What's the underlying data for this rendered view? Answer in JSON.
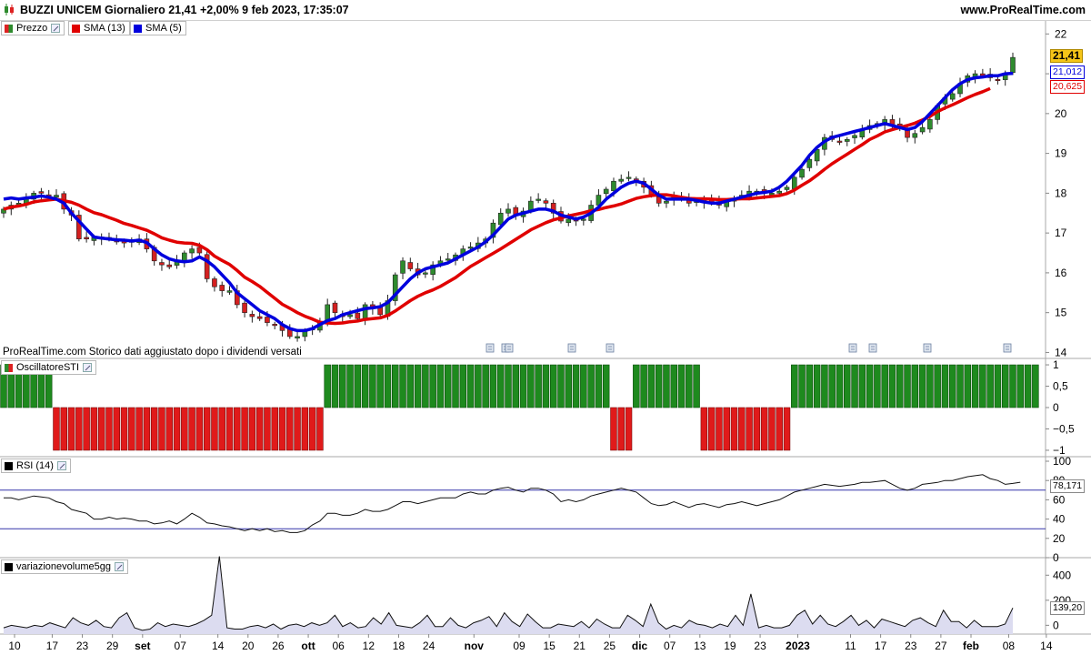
{
  "header": {
    "title": "BUZZI UNICEM Giornaliero 21,41 +2,00% 9 feb 2023, 17:35:07",
    "site": "www.ProRealTime.com"
  },
  "panels": {
    "price": {
      "legend": [
        {
          "label": "Prezzo",
          "color": "#2e8b2e"
        },
        {
          "label": "SMA (13)",
          "color": "#e00000"
        },
        {
          "label": "SMA (5)",
          "color": "#0000dd"
        }
      ],
      "note": "ProRealTime.com  Storico dati aggiustato dopo i dividendi versati",
      "y_ticks": [
        "14",
        "15",
        "16",
        "17",
        "18",
        "19",
        "20",
        "21",
        "22"
      ],
      "value_boxes": {
        "price": "21,41",
        "sma5": "21,012",
        "sma13": "20,625"
      }
    },
    "oscillator": {
      "label": "OscillatoreSTI",
      "y_ticks": [
        "1",
        "0,5",
        "0",
        "−0,5",
        "−1"
      ]
    },
    "rsi": {
      "label": "RSI (14)",
      "y_ticks": [
        "100",
        "80",
        "60",
        "40",
        "20",
        "0"
      ],
      "value_box": "78,171"
    },
    "volume": {
      "label": "variazionevolume5gg",
      "y_ticks": [
        "400",
        "200",
        "0"
      ],
      "value_box": "139,20"
    }
  },
  "x_axis": {
    "labels": [
      {
        "text": "10",
        "i": 0,
        "bold": false
      },
      {
        "text": "17",
        "i": 5,
        "bold": false
      },
      {
        "text": "23",
        "i": 9,
        "bold": false
      },
      {
        "text": "29",
        "i": 13,
        "bold": false
      },
      {
        "text": "set",
        "i": 17,
        "bold": true
      },
      {
        "text": "07",
        "i": 22,
        "bold": false
      },
      {
        "text": "14",
        "i": 27,
        "bold": false
      },
      {
        "text": "20",
        "i": 31,
        "bold": false
      },
      {
        "text": "26",
        "i": 35,
        "bold": false
      },
      {
        "text": "ott",
        "i": 39,
        "bold": true
      },
      {
        "text": "06",
        "i": 43,
        "bold": false
      },
      {
        "text": "12",
        "i": 47,
        "bold": false
      },
      {
        "text": "18",
        "i": 51,
        "bold": false
      },
      {
        "text": "24",
        "i": 55,
        "bold": false
      },
      {
        "text": "nov",
        "i": 61,
        "bold": true
      },
      {
        "text": "09",
        "i": 67,
        "bold": false
      },
      {
        "text": "15",
        "i": 71,
        "bold": false
      },
      {
        "text": "21",
        "i": 75,
        "bold": false
      },
      {
        "text": "25",
        "i": 79,
        "bold": false
      },
      {
        "text": "dic",
        "i": 83,
        "bold": true
      },
      {
        "text": "07",
        "i": 87,
        "bold": false
      },
      {
        "text": "13",
        "i": 91,
        "bold": false
      },
      {
        "text": "19",
        "i": 95,
        "bold": false
      },
      {
        "text": "23",
        "i": 99,
        "bold": false
      },
      {
        "text": "2023",
        "i": 104,
        "bold": true
      },
      {
        "text": "11",
        "i": 111,
        "bold": false
      },
      {
        "text": "17",
        "i": 115,
        "bold": false
      },
      {
        "text": "23",
        "i": 119,
        "bold": false
      },
      {
        "text": "27",
        "i": 123,
        "bold": false
      },
      {
        "text": "feb",
        "i": 127,
        "bold": true
      },
      {
        "text": "08",
        "i": 132,
        "bold": false
      },
      {
        "text": "14",
        "i": 137,
        "bold": false
      }
    ]
  },
  "chart_data": [
    {
      "type": "candlestick",
      "title": "BUZZI UNICEM Giornaliero",
      "series": [
        {
          "name": "Prezzo",
          "values": [
            17.6,
            17.7,
            17.75,
            17.85,
            18.0,
            18.0,
            17.9,
            17.95,
            17.6,
            17.45,
            16.85,
            16.85,
            16.9,
            16.85,
            16.85,
            16.8,
            16.75,
            16.8,
            16.85,
            16.6,
            16.3,
            16.2,
            16.15,
            16.3,
            16.5,
            16.6,
            16.5,
            15.85,
            15.65,
            15.55,
            15.55,
            15.2,
            15.0,
            14.9,
            14.85,
            14.75,
            14.7,
            14.55,
            14.4,
            14.4,
            14.55,
            14.6,
            14.75,
            15.2,
            15.0,
            14.9,
            14.95,
            14.85,
            15.2,
            15.1,
            14.95,
            15.3,
            15.95,
            16.3,
            16.1,
            15.95,
            16.0,
            16.2,
            16.3,
            16.35,
            16.45,
            16.6,
            16.65,
            16.75,
            16.85,
            17.25,
            17.5,
            17.6,
            17.45,
            17.55,
            17.8,
            17.85,
            17.75,
            17.5,
            17.3,
            17.35,
            17.3,
            17.35,
            17.7,
            17.95,
            18.1,
            18.3,
            18.35,
            18.4,
            18.3,
            18.15,
            17.95,
            17.75,
            17.8,
            17.95,
            17.85,
            17.75,
            17.8,
            17.85,
            17.75,
            17.7,
            17.8,
            17.85,
            17.95,
            18.05,
            18.05,
            18.0,
            18.0,
            18.05,
            18.15,
            18.4,
            18.6,
            18.85,
            19.1,
            19.4,
            19.35,
            19.3,
            19.35,
            19.45,
            19.6,
            19.7,
            19.75,
            19.85,
            19.7,
            19.65,
            19.4,
            19.5,
            19.65,
            19.85,
            20.2,
            20.4,
            20.5,
            20.75,
            20.95,
            21.0,
            20.95,
            20.9,
            20.85,
            20.99,
            21.41
          ]
        },
        {
          "name": "SMA (13)",
          "values": [
            17.6,
            17.65,
            17.68,
            17.72,
            17.78,
            17.81,
            17.83,
            17.85,
            17.81,
            17.77,
            17.7,
            17.6,
            17.51,
            17.46,
            17.39,
            17.32,
            17.24,
            17.19,
            17.13,
            17.07,
            16.98,
            16.88,
            16.82,
            16.77,
            16.75,
            16.74,
            16.69,
            16.58,
            16.42,
            16.31,
            16.21,
            16.06,
            15.89,
            15.78,
            15.66,
            15.51,
            15.36,
            15.21,
            15.11,
            15.0,
            14.91,
            14.84,
            14.76,
            14.74,
            14.73,
            14.74,
            14.77,
            14.79,
            14.83,
            14.85,
            14.87,
            14.93,
            15.04,
            15.17,
            15.3,
            15.41,
            15.5,
            15.57,
            15.66,
            15.77,
            15.88,
            16.02,
            16.16,
            16.27,
            16.38,
            16.49,
            16.6,
            16.72,
            16.84,
            16.96,
            17.08,
            17.17,
            17.26,
            17.33,
            17.38,
            17.43,
            17.47,
            17.51,
            17.56,
            17.59,
            17.64,
            17.68,
            17.73,
            17.8,
            17.87,
            17.91,
            17.94,
            17.96,
            17.96,
            17.93,
            17.9,
            17.87,
            17.86,
            17.86,
            17.85,
            17.84,
            17.84,
            17.85,
            17.86,
            17.86,
            17.88,
            17.9,
            17.92,
            17.94,
            17.99,
            18.08,
            18.2,
            18.31,
            18.45,
            18.6,
            18.74,
            18.86,
            18.98,
            19.1,
            19.22,
            19.35,
            19.44,
            19.54,
            19.6,
            19.65,
            19.7,
            19.76,
            19.84,
            19.93,
            20.05,
            20.14,
            20.22,
            20.31,
            20.4,
            20.48,
            20.55,
            20.63
          ]
        },
        {
          "name": "SMA (5)",
          "values": [
            17.85,
            17.88,
            17.85,
            17.88,
            17.9,
            17.93,
            17.9,
            17.85,
            17.75,
            17.5,
            17.3,
            17.1,
            16.9,
            16.87,
            16.85,
            16.83,
            16.82,
            16.8,
            16.82,
            16.76,
            16.6,
            16.45,
            16.35,
            16.3,
            16.28,
            16.3,
            16.4,
            16.3,
            16.15,
            15.95,
            15.75,
            15.5,
            15.35,
            15.2,
            15.05,
            14.95,
            14.85,
            14.7,
            14.6,
            14.55,
            14.55,
            14.6,
            14.7,
            14.8,
            14.85,
            14.95,
            15.0,
            15.05,
            15.1,
            15.12,
            15.15,
            15.25,
            15.45,
            15.65,
            15.85,
            16.0,
            16.1,
            16.15,
            16.2,
            16.25,
            16.35,
            16.45,
            16.55,
            16.65,
            16.78,
            16.95,
            17.15,
            17.35,
            17.45,
            17.5,
            17.55,
            17.6,
            17.6,
            17.55,
            17.45,
            17.4,
            17.35,
            17.4,
            17.5,
            17.65,
            17.85,
            18.0,
            18.15,
            18.25,
            18.3,
            18.25,
            18.1,
            17.95,
            17.85,
            17.85,
            17.85,
            17.85,
            17.82,
            17.78,
            17.75,
            17.75,
            17.8,
            17.85,
            17.9,
            17.95,
            18.0,
            18.02,
            18.05,
            18.15,
            18.3,
            18.5,
            18.7,
            18.95,
            19.15,
            19.3,
            19.4,
            19.45,
            19.5,
            19.55,
            19.6,
            19.65,
            19.7,
            19.75,
            19.7,
            19.65,
            19.6,
            19.65,
            19.8,
            20.0,
            20.2,
            20.4,
            20.6,
            20.75,
            20.85,
            20.9,
            20.92,
            20.95,
            20.95,
            21.0,
            21.01
          ]
        }
      ],
      "ylim": [
        13.85,
        22.35
      ]
    },
    {
      "type": "bar",
      "title": "OscillatoreSTI",
      "values": [
        1,
        1,
        1,
        1,
        1,
        1,
        1,
        -1,
        -1,
        -1,
        -1,
        -1,
        -1,
        -1,
        -1,
        -1,
        -1,
        -1,
        -1,
        -1,
        -1,
        -1,
        -1,
        -1,
        -1,
        -1,
        -1,
        -1,
        -1,
        -1,
        -1,
        -1,
        -1,
        -1,
        -1,
        -1,
        -1,
        -1,
        -1,
        -1,
        -1,
        -1,
        -1,
        1,
        1,
        1,
        1,
        1,
        1,
        1,
        1,
        1,
        1,
        1,
        1,
        1,
        1,
        1,
        1,
        1,
        1,
        1,
        1,
        1,
        1,
        1,
        1,
        1,
        1,
        1,
        1,
        1,
        1,
        1,
        1,
        1,
        1,
        1,
        1,
        1,
        1,
        -1,
        -1,
        -1,
        1,
        1,
        1,
        1,
        1,
        1,
        1,
        1,
        1,
        -1,
        -1,
        -1,
        -1,
        -1,
        -1,
        -1,
        -1,
        -1,
        -1,
        -1,
        -1,
        1,
        1,
        1,
        1,
        1,
        1,
        1,
        1,
        1,
        1,
        1,
        1,
        1,
        1,
        1,
        1,
        1,
        1,
        1,
        1,
        1,
        1,
        1,
        1,
        1,
        1,
        1,
        1,
        1,
        1,
        1,
        1,
        1
      ],
      "ylim": [
        -1.15,
        1.15
      ]
    },
    {
      "type": "line",
      "title": "RSI (14)",
      "values": [
        62,
        62,
        60,
        62,
        64,
        63,
        62,
        58,
        56,
        50,
        48,
        46,
        40,
        40,
        42,
        40,
        41,
        40,
        38,
        38,
        35,
        36,
        38,
        35,
        40,
        46,
        42,
        36,
        35,
        33,
        32,
        30,
        28,
        30,
        28,
        30,
        27,
        28,
        26,
        26,
        28,
        34,
        38,
        46,
        46,
        44,
        44,
        46,
        50,
        48,
        48,
        50,
        54,
        58,
        58,
        56,
        58,
        60,
        62,
        62,
        62,
        66,
        68,
        66,
        66,
        70,
        72,
        73,
        70,
        68,
        72,
        72,
        70,
        66,
        58,
        60,
        58,
        60,
        64,
        66,
        68,
        70,
        72,
        70,
        68,
        62,
        56,
        54,
        55,
        58,
        55,
        52,
        55,
        56,
        54,
        52,
        55,
        56,
        58,
        56,
        54,
        56,
        58,
        60,
        64,
        68,
        70,
        72,
        74,
        76,
        75,
        74,
        75,
        76,
        78,
        78,
        79,
        80,
        76,
        72,
        70,
        72,
        76,
        77,
        78,
        80,
        80,
        82,
        84,
        85,
        86,
        82,
        80,
        76,
        77,
        78.17
      ],
      "hlines": [
        70,
        30
      ],
      "ylim": [
        0,
        100
      ]
    },
    {
      "type": "area",
      "title": "variazionevolume5gg",
      "values": [
        -20,
        0,
        -10,
        -20,
        0,
        -10,
        20,
        0,
        -20,
        60,
        20,
        0,
        40,
        -10,
        -20,
        60,
        100,
        -20,
        -40,
        -30,
        20,
        -10,
        10,
        0,
        -10,
        10,
        40,
        80,
        550,
        -20,
        -30,
        -30,
        -10,
        0,
        -20,
        10,
        -30,
        0,
        10,
        -10,
        20,
        0,
        20,
        80,
        -10,
        20,
        -20,
        -10,
        60,
        10,
        100,
        0,
        -10,
        -20,
        20,
        80,
        -10,
        -10,
        60,
        0,
        -20,
        20,
        40,
        70,
        -10,
        100,
        30,
        -10,
        90,
        30,
        -20,
        -20,
        10,
        0,
        -10,
        30,
        -20,
        50,
        10,
        -20,
        -20,
        80,
        40,
        -10,
        170,
        20,
        -30,
        0,
        -20,
        40,
        10,
        0,
        -20,
        10,
        -10,
        80,
        0,
        250,
        -20,
        0,
        -20,
        -20,
        0,
        80,
        120,
        10,
        80,
        10,
        -10,
        30,
        80,
        0,
        40,
        -20,
        50,
        30,
        10,
        -10,
        40,
        60,
        20,
        -10,
        120,
        30,
        30,
        -20,
        40,
        -10,
        -10,
        -10,
        10,
        139.2
      ],
      "ylim": [
        -70,
        540
      ]
    }
  ]
}
